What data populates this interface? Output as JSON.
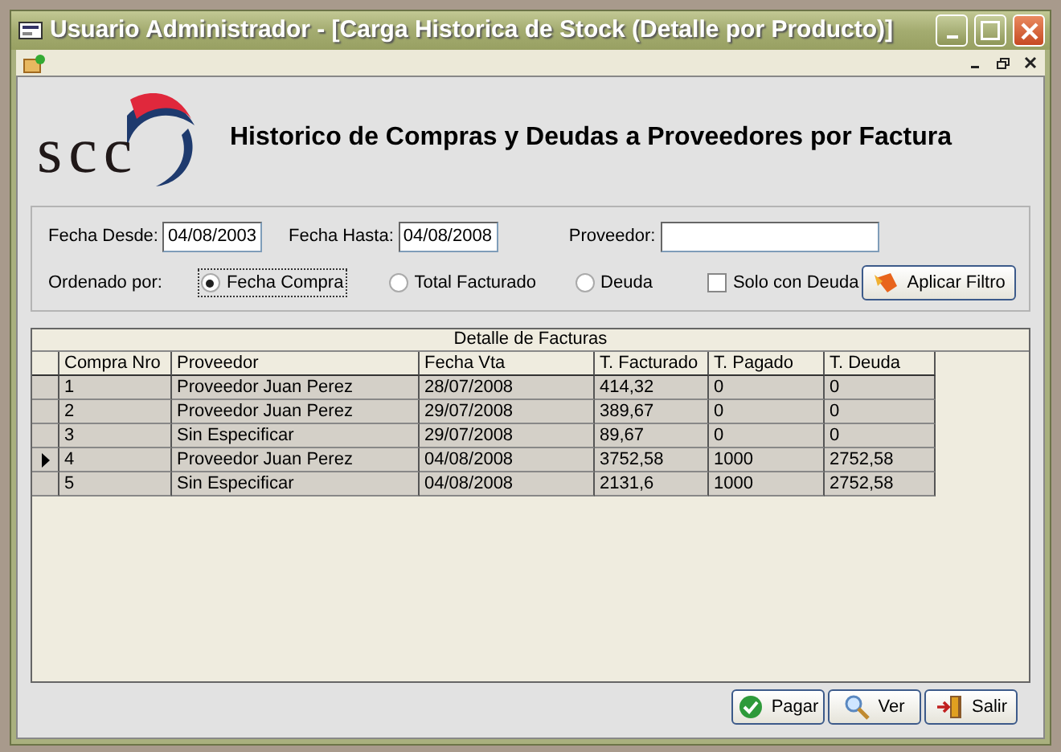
{
  "window": {
    "title": "Usuario Administrador - [Carga Historica de Stock (Detalle por Producto)]"
  },
  "header": {
    "logo_text": "scc",
    "title": "Historico de Compras y Deudas a Proveedores por Factura"
  },
  "filter": {
    "fields": [
      {
        "label": "Fecha Desde:",
        "value": "04/08/2003"
      },
      {
        "label": "Fecha Hasta:",
        "value": "04/08/2008"
      },
      {
        "label": "Proveedor:"
      }
    ],
    "order_label": "Ordenado por:",
    "order_options": [
      {
        "label": "Fecha Compra",
        "selected": true
      },
      {
        "label": "Total Facturado",
        "selected": false
      },
      {
        "label": "Deuda",
        "selected": false
      }
    ],
    "only_debt": {
      "label": "Solo con Deuda",
      "checked": false
    },
    "apply_button": "Aplicar Filtro"
  },
  "grid": {
    "caption": "Detalle de Facturas",
    "columns": [
      "Compra Nro",
      "Proveedor",
      "Fecha Vta",
      "T. Facturado",
      "T. Pagado",
      "T. Deuda"
    ],
    "rows": [
      {
        "current": false,
        "cells": [
          "1",
          "Proveedor Juan Perez",
          "28/07/2008",
          "414,32",
          "0",
          "0"
        ]
      },
      {
        "current": false,
        "cells": [
          "2",
          "Proveedor Juan Perez",
          "29/07/2008",
          "389,67",
          "0",
          "0"
        ]
      },
      {
        "current": false,
        "cells": [
          "3",
          "Sin Especificar",
          "29/07/2008",
          "89,67",
          "0",
          "0"
        ]
      },
      {
        "current": true,
        "cells": [
          "4",
          "Proveedor Juan Perez",
          "04/08/2008",
          "3752,58",
          "1000",
          "2752,58"
        ]
      },
      {
        "current": false,
        "cells": [
          "5",
          "Sin Especificar",
          "04/08/2008",
          "2131,6",
          "1000",
          "2752,58"
        ]
      }
    ]
  },
  "buttons": [
    {
      "kind": "pay",
      "label": "Pagar"
    },
    {
      "kind": "view",
      "label": "Ver"
    },
    {
      "kind": "exit",
      "label": "Salir"
    }
  ]
}
